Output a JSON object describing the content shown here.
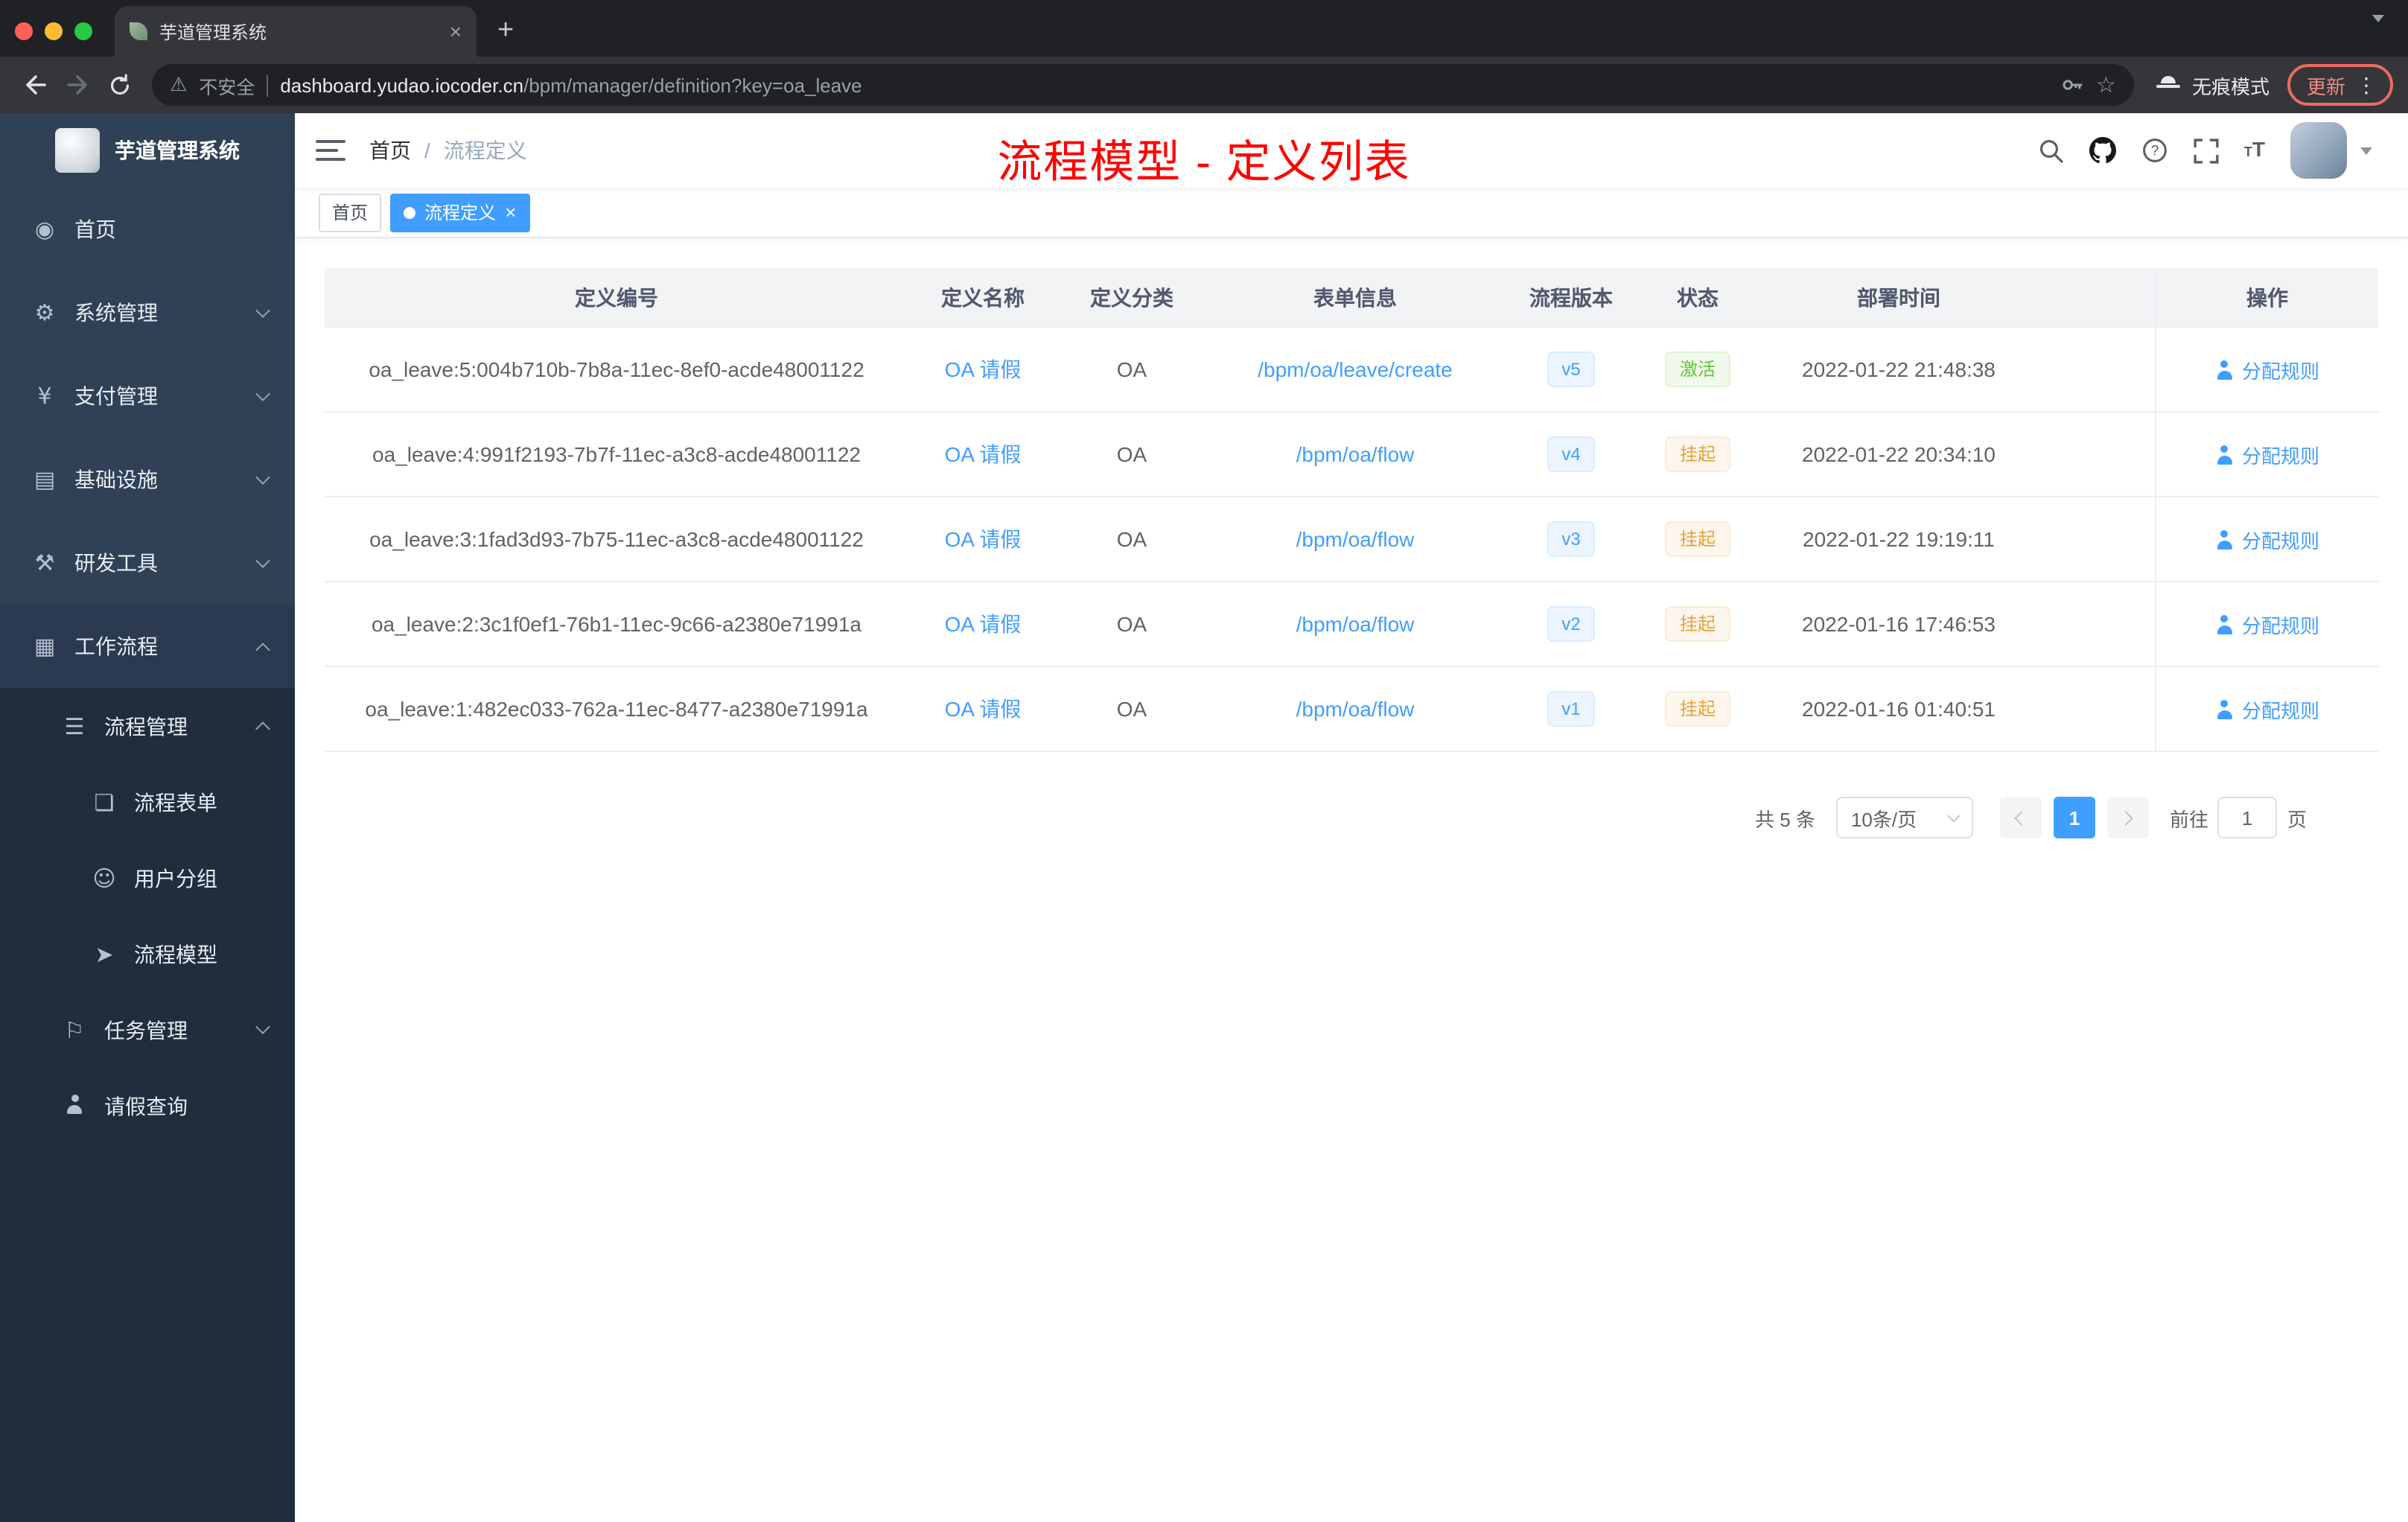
{
  "colors": {
    "accent": "#409eff",
    "success": "#67c23a",
    "warning": "#e6a23c",
    "annotation_red": "#ff0000",
    "sidebar_bg": "#304156",
    "sidebar_sub_bg": "#1f2d3d"
  },
  "browser": {
    "tab_title": "芋道管理系统",
    "security_label": "不安全",
    "url_host": "dashboard.yudao.iocoder.cn",
    "url_path": "/bpm/manager/definition?key=oa_leave",
    "incognito_label": "无痕模式",
    "update_label": "更新"
  },
  "sidebar": {
    "brand": "芋道管理系统",
    "items": [
      {
        "label": "首页",
        "glyph": "◉"
      },
      {
        "label": "系统管理",
        "glyph": "⚙"
      },
      {
        "label": "支付管理",
        "glyph": "¥"
      },
      {
        "label": "基础设施",
        "glyph": "▤"
      },
      {
        "label": "研发工具",
        "glyph": "⚒"
      },
      {
        "label": "工作流程",
        "glyph": "▦"
      },
      {
        "label": "流程管理",
        "glyph": "☰"
      },
      {
        "label": "流程表单",
        "glyph": "❏"
      },
      {
        "label": "用户分组",
        "glyph": "☺"
      },
      {
        "label": "流程模型",
        "glyph": "➤"
      },
      {
        "label": "任务管理",
        "glyph": "⚐"
      },
      {
        "label": "请假查询",
        "glyph": ""
      }
    ]
  },
  "header": {
    "breadcrumb_home": "首页",
    "breadcrumb_current": "流程定义",
    "annotation": "流程模型 - 定义列表"
  },
  "tags": {
    "home": "首页",
    "active": "流程定义"
  },
  "table": {
    "columns": [
      "定义编号",
      "定义名称",
      "定义分类",
      "表单信息",
      "流程版本",
      "状态",
      "部署时间",
      "操作"
    ],
    "rows": [
      {
        "id": "oa_leave:5:004b710b-7b8a-11ec-8ef0-acde48001122",
        "name": "OA 请假",
        "category": "OA",
        "form": "/bpm/oa/leave/create",
        "version": "v5",
        "status": "激活",
        "time": "2022-01-22 21:48:38",
        "action": "分配规则"
      },
      {
        "id": "oa_leave:4:991f2193-7b7f-11ec-a3c8-acde48001122",
        "name": "OA 请假",
        "category": "OA",
        "form": "/bpm/oa/flow",
        "version": "v4",
        "status": "挂起",
        "time": "2022-01-22 20:34:10",
        "action": "分配规则"
      },
      {
        "id": "oa_leave:3:1fad3d93-7b75-11ec-a3c8-acde48001122",
        "name": "OA 请假",
        "category": "OA",
        "form": "/bpm/oa/flow",
        "version": "v3",
        "status": "挂起",
        "time": "2022-01-22 19:19:11",
        "action": "分配规则"
      },
      {
        "id": "oa_leave:2:3c1f0ef1-76b1-11ec-9c66-a2380e71991a",
        "name": "OA 请假",
        "category": "OA",
        "form": "/bpm/oa/flow",
        "version": "v2",
        "status": "挂起",
        "time": "2022-01-16 17:46:53",
        "action": "分配规则"
      },
      {
        "id": "oa_leave:1:482ec033-762a-11ec-8477-a2380e71991a",
        "name": "OA 请假",
        "category": "OA",
        "form": "/bpm/oa/flow",
        "version": "v1",
        "status": "挂起",
        "time": "2022-01-16 01:40:51",
        "action": "分配规则"
      }
    ]
  },
  "pagination": {
    "total": "共 5 条",
    "page_size": "10条/页",
    "current_page": "1",
    "goto_label": "前往",
    "goto_value": "1",
    "unit_label": "页"
  }
}
